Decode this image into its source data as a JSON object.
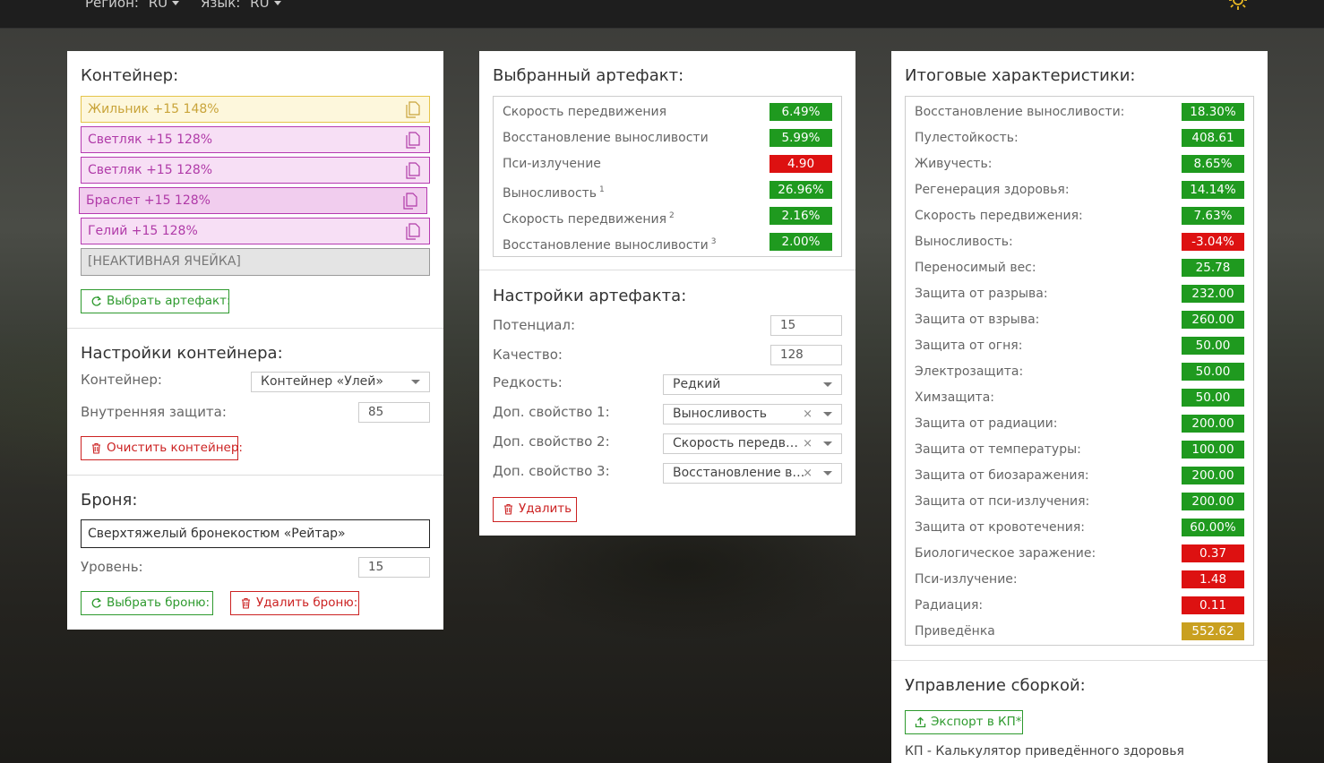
{
  "topbar": {
    "region_label": "Регион:",
    "region_value": "RU",
    "lang_label": "Язык:",
    "lang_value": "RU"
  },
  "container_panel": {
    "title": "Контейнер:",
    "slots": [
      {
        "label": "Жильник +15 148%",
        "style": "gold"
      },
      {
        "label": "Светляк +15 128%",
        "style": "purple"
      },
      {
        "label": "Светляк +15 128%",
        "style": "purple"
      },
      {
        "label": "Браслет +15 128%",
        "style": "purple-selected"
      },
      {
        "label": "Гелий +15 128%",
        "style": "purple"
      },
      {
        "label": "[НЕАКТИВНАЯ ЯЧЕЙКА]",
        "style": "inactive"
      }
    ],
    "choose_btn": "Выбрать артефакт:",
    "settings_title": "Настройки контейнера:",
    "container_label": "Контейнер:",
    "container_value": "Контейнер «Улей»",
    "protection_label": "Внутренняя защита:",
    "protection_value": "85",
    "clear_btn": "Очистить контейнер:",
    "armor_title": "Броня:",
    "armor_value": "Сверхтяжелый бронекостюм «Рейтар»",
    "level_label": "Уровень:",
    "level_value": "15",
    "choose_armor_btn": "Выбрать броню:",
    "delete_armor_btn": "Удалить броню:"
  },
  "artifact_panel": {
    "title": "Выбранный артефакт:",
    "stats": [
      {
        "name": "Скорость передвижения",
        "sup": "",
        "value": "6.49%",
        "color": "g"
      },
      {
        "name": "Восстановление выносливости",
        "sup": "",
        "value": "5.99%",
        "color": "g"
      },
      {
        "name": "Пси-излучение",
        "sup": "",
        "value": "4.90",
        "color": "r"
      },
      {
        "name": "Выносливость",
        "sup": "1",
        "value": "26.96%",
        "color": "g"
      },
      {
        "name": "Скорость передвижения",
        "sup": "2",
        "value": "2.16%",
        "color": "g"
      },
      {
        "name": "Восстановление выносливости",
        "sup": "3",
        "value": "2.00%",
        "color": "g"
      }
    ],
    "settings_title": "Настройки артефакта:",
    "potential_label": "Потенциал:",
    "potential_value": "15",
    "quality_label": "Качество:",
    "quality_value": "128",
    "rarity_label": "Редкость:",
    "rarity_value": "Редкий",
    "extra1_label": "Доп. свойство 1:",
    "extra1_value": "Выносливость",
    "extra2_label": "Доп. свойство 2:",
    "extra2_value": "Скорость передвижения",
    "extra3_label": "Доп. свойство 3:",
    "extra3_value": "Восстановление выносливости",
    "clear_symbol": "×",
    "delete_btn": "Удалить"
  },
  "totals_panel": {
    "title": "Итоговые характеристики:",
    "stats": [
      {
        "name": "Восстановление выносливости:",
        "value": "18.30%",
        "color": "g"
      },
      {
        "name": "Пулестойкость:",
        "value": "408.61",
        "color": "g"
      },
      {
        "name": "Живучесть:",
        "value": "8.65%",
        "color": "g"
      },
      {
        "name": "Регенерация здоровья:",
        "value": "14.14%",
        "color": "g"
      },
      {
        "name": "Скорость передвижения:",
        "value": "7.63%",
        "color": "g"
      },
      {
        "name": "Выносливость:",
        "value": "-3.04%",
        "color": "r"
      },
      {
        "name": "Переносимый вес:",
        "value": "25.78",
        "color": "g"
      },
      {
        "name": "Защита от разрыва:",
        "value": "232.00",
        "color": "g"
      },
      {
        "name": "Защита от взрыва:",
        "value": "260.00",
        "color": "g"
      },
      {
        "name": "Защита от огня:",
        "value": "50.00",
        "color": "g"
      },
      {
        "name": "Электрозащита:",
        "value": "50.00",
        "color": "g"
      },
      {
        "name": "Химзащита:",
        "value": "50.00",
        "color": "g"
      },
      {
        "name": "Защита от радиации:",
        "value": "200.00",
        "color": "g"
      },
      {
        "name": "Защита от температуры:",
        "value": "100.00",
        "color": "g"
      },
      {
        "name": "Защита от биозаражения:",
        "value": "200.00",
        "color": "g"
      },
      {
        "name": "Защита от пси-излучения:",
        "value": "200.00",
        "color": "g"
      },
      {
        "name": "Защита от кровотечения:",
        "value": "60.00%",
        "color": "g"
      },
      {
        "name": "Биологическое заражение:",
        "value": "0.37",
        "color": "r"
      },
      {
        "name": "Пси-излучение:",
        "value": "1.48",
        "color": "r"
      },
      {
        "name": "Радиация:",
        "value": "0.11",
        "color": "r"
      },
      {
        "name": "Приведёнка",
        "value": "552.62",
        "color": "y"
      }
    ],
    "build_title": "Управление сборкой:",
    "export_btn": "Экспорт в КП*",
    "footnote": "КП - Калькулятор приведённого здоровья"
  }
}
